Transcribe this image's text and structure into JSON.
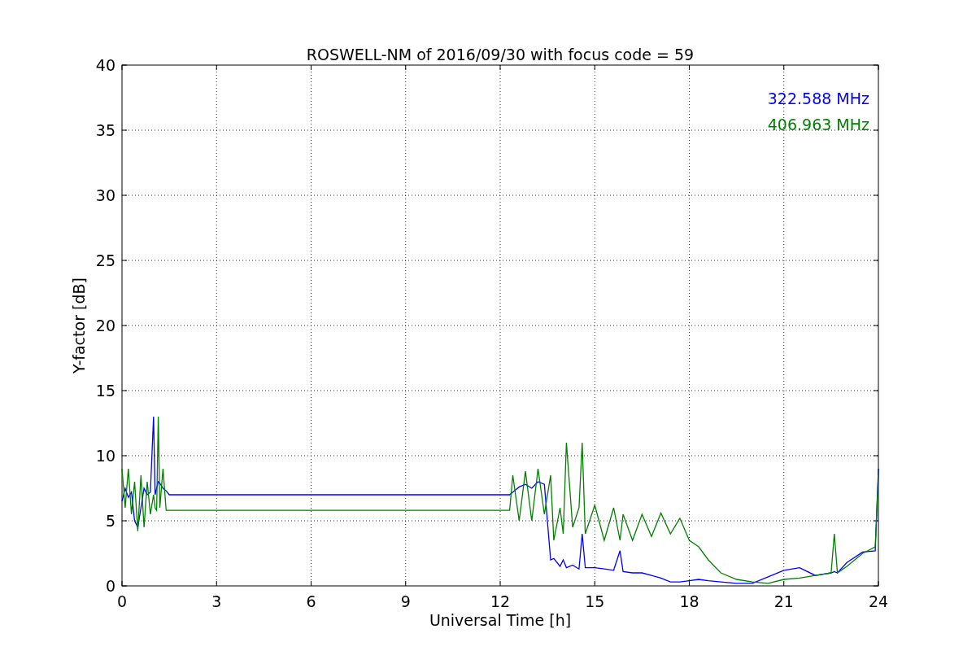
{
  "chart_data": {
    "type": "line",
    "grid": true,
    "title": "ROSWELL-NM of 2016/09/30 with focus code = 59",
    "xlabel": "Universal Time [h]",
    "ylabel": "Y-factor [dB]",
    "x": [
      0,
      0.1,
      0.2,
      0.3,
      0.4,
      0.5,
      0.6,
      0.7,
      0.8,
      0.9,
      1.0,
      1.05,
      1.1,
      1.15,
      1.2,
      1.3,
      1.4,
      1.5,
      12.3,
      12.4,
      12.6,
      12.8,
      13.0,
      13.2,
      13.4,
      13.6,
      13.7,
      13.9,
      14.0,
      14.1,
      14.3,
      14.5,
      14.6,
      14.7,
      15.0,
      15.3,
      15.6,
      15.8,
      15.9,
      16.2,
      16.5,
      16.8,
      17.1,
      17.4,
      17.7,
      18.0,
      18.3,
      18.6,
      19.0,
      19.5,
      20.0,
      20.5,
      21.0,
      21.5,
      22.0,
      22.5,
      22.6,
      22.7,
      23.0,
      23.5,
      23.9,
      24.0
    ],
    "series": [
      {
        "name": "322.588 MHz",
        "color": "#0000ff",
        "values": [
          6.5,
          7.5,
          6.8,
          7.2,
          5,
          4.5,
          6,
          7.5,
          7,
          7.2,
          13,
          7,
          7.5,
          8,
          7.9,
          7.5,
          7.3,
          7,
          7,
          7.2,
          7.6,
          7.8,
          7.5,
          8,
          7.8,
          2,
          2.1,
          1.5,
          2,
          1.4,
          1.6,
          1.3,
          4,
          1.4,
          1.4,
          1.3,
          1.2,
          2.7,
          1.1,
          1,
          1,
          0.8,
          0.6,
          0.3,
          0.3,
          0.4,
          0.5,
          0.4,
          0.3,
          0.2,
          0.2,
          0.7,
          1.2,
          1.4,
          0.8,
          1,
          1.1,
          1,
          1.8,
          2.6,
          2.7,
          9
        ]
      },
      {
        "name": "406.963 MHz",
        "color": "#008000",
        "values": [
          9,
          6,
          9,
          5.5,
          8,
          4.2,
          8.5,
          4.5,
          8,
          5.5,
          7,
          6,
          5.8,
          13,
          6,
          9,
          5.8,
          5.8,
          5.8,
          8.5,
          5,
          8.8,
          5,
          9,
          5.5,
          8.5,
          3.5,
          6,
          4,
          11,
          4.5,
          6,
          11,
          4,
          6.2,
          3.5,
          6,
          3.5,
          5.5,
          3.5,
          5.5,
          3.8,
          5.6,
          4,
          5.2,
          3.5,
          3,
          2,
          1,
          0.5,
          0.3,
          0.2,
          0.5,
          0.6,
          0.8,
          1,
          4,
          1,
          1.5,
          2.5,
          3,
          8.5
        ]
      }
    ],
    "xlim": [
      0,
      24
    ],
    "ylim": [
      0,
      40
    ],
    "xticks": [
      0,
      3,
      6,
      9,
      12,
      15,
      18,
      21,
      24
    ],
    "yticks": [
      0,
      5,
      10,
      15,
      20,
      25,
      30,
      35,
      40
    ]
  }
}
